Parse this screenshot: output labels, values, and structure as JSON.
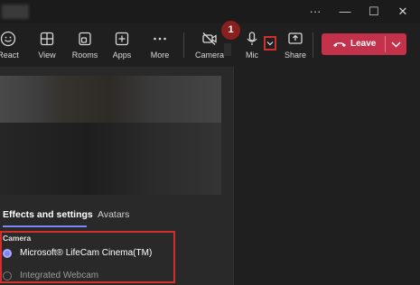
{
  "window": {
    "controls": [
      "more-icon",
      "minimize-icon",
      "maximize-icon",
      "close-icon"
    ],
    "more_glyph": "···",
    "min_glyph": "—",
    "max_glyph": "☐",
    "close_glyph": "✕"
  },
  "toolbar": {
    "react_label": "React",
    "view_label": "View",
    "rooms_label": "Rooms",
    "apps_label": "Apps",
    "more_label": "More",
    "camera_label": "Camera",
    "mic_label": "Mic",
    "share_label": "Share",
    "leave_label": "Leave"
  },
  "annotation": {
    "step": "1"
  },
  "settings": {
    "tabs": [
      "Effects and settings",
      "Avatars"
    ],
    "active_tab": 0,
    "camera_section_label": "Camera",
    "camera_options": [
      {
        "label": "Microsoft® LifeCam Cinema(TM)",
        "selected": true
      },
      {
        "label": "Integrated Webcam",
        "selected": false
      }
    ]
  },
  "colors": {
    "accent": "#7f85f5",
    "leave": "#c4314b",
    "highlight": "#d12e2e"
  }
}
